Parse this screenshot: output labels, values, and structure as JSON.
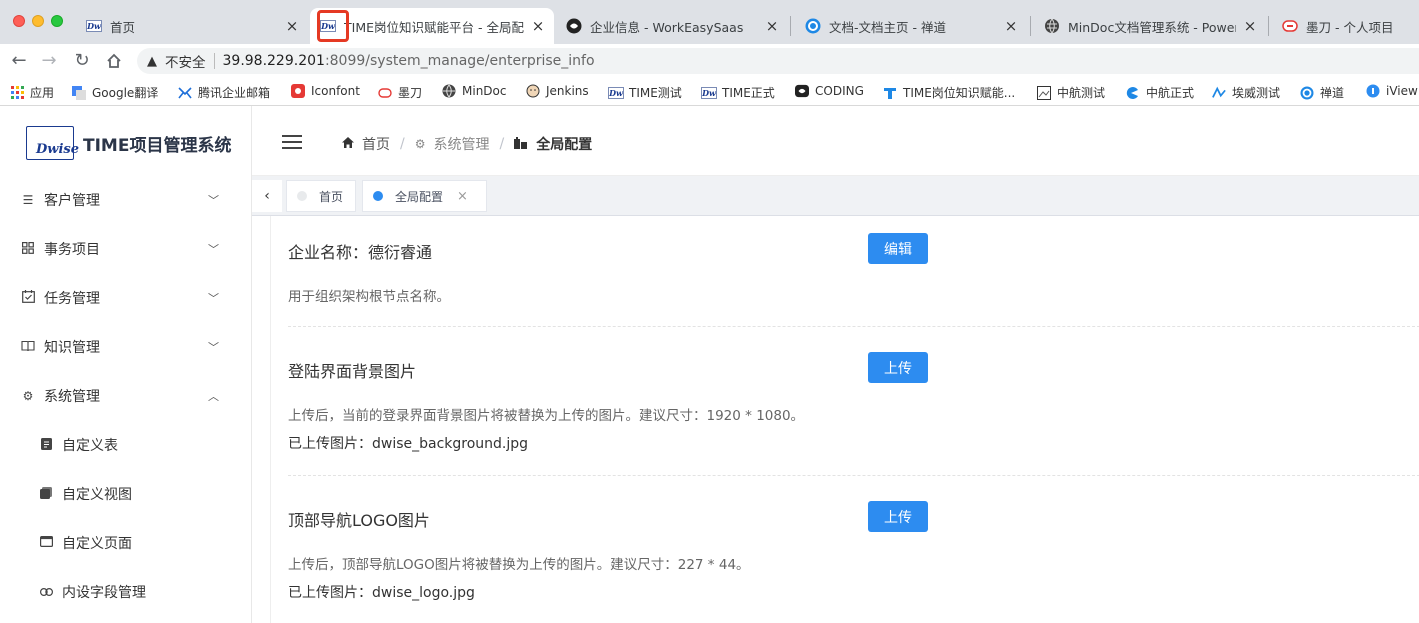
{
  "browser": {
    "tabs": [
      {
        "title": "首页",
        "favicon": "dwise-logo-icon",
        "active": false
      },
      {
        "title": "TIME岗位知识赋能平台 - 全局配",
        "favicon": "dwise-logo-icon",
        "active": true
      },
      {
        "title": "企业信息 - WorkEasySaas",
        "favicon": "workeasy-icon",
        "active": false
      },
      {
        "title": "文档-文档主页 - 禅道",
        "favicon": "zentao-icon",
        "active": false
      },
      {
        "title": "MinDoc文档管理系统 - Powered",
        "favicon": "globe-icon",
        "active": false
      },
      {
        "title": "墨刀 - 个人项目",
        "favicon": "modao-icon",
        "active": false
      }
    ],
    "address": {
      "security_label": "不安全",
      "host": "39.98.229.201",
      "path": ":8099/system_manage/enterprise_info"
    },
    "bookmarks": [
      {
        "label": "应用",
        "icon": "apps-grid-icon"
      },
      {
        "label": "Google翻译",
        "icon": "google-translate-icon"
      },
      {
        "label": "腾讯企业邮箱",
        "icon": "tencent-mail-icon"
      },
      {
        "label": "Iconfont",
        "icon": "iconfont-icon"
      },
      {
        "label": "墨刀",
        "icon": "modao-icon"
      },
      {
        "label": "MinDoc",
        "icon": "globe-icon"
      },
      {
        "label": "Jenkins",
        "icon": "jenkins-icon"
      },
      {
        "label": "TIME测试",
        "icon": "dwise-logo-icon"
      },
      {
        "label": "TIME正式",
        "icon": "dwise-logo-icon"
      },
      {
        "label": "CODING",
        "icon": "coding-icon"
      },
      {
        "label": "TIME岗位知识赋能...",
        "icon": "time-platform-icon"
      },
      {
        "label": "中航测试",
        "icon": "image-icon"
      },
      {
        "label": "中航正式",
        "icon": "edge-icon"
      },
      {
        "label": "埃威测试",
        "icon": "aiwei-icon"
      },
      {
        "label": "禅道",
        "icon": "zentao-icon"
      },
      {
        "label": "iView",
        "icon": "iview-icon"
      }
    ]
  },
  "app": {
    "logo_badge": "Dwise",
    "brand": "TIME项目管理系统",
    "menu": [
      {
        "label": "客户管理",
        "icon": "list-icon",
        "expanded": false
      },
      {
        "label": "事务项目",
        "icon": "grid-icon",
        "expanded": false
      },
      {
        "label": "任务管理",
        "icon": "calendar-check-icon",
        "expanded": false
      },
      {
        "label": "知识管理",
        "icon": "book-icon",
        "expanded": false
      },
      {
        "label": "系统管理",
        "icon": "gear-icon",
        "expanded": true
      }
    ],
    "submenu": [
      {
        "label": "自定义表",
        "icon": "doc-icon"
      },
      {
        "label": "自定义视图",
        "icon": "copy-icon"
      },
      {
        "label": "自定义页面",
        "icon": "window-icon"
      },
      {
        "label": "内设字段管理",
        "icon": "link-icon"
      }
    ],
    "breadcrumb": [
      {
        "label": "首页",
        "icon": "home-icon"
      },
      {
        "label": "系统管理",
        "icon": "gear-icon"
      },
      {
        "label": "全局配置",
        "icon": "building-icon"
      }
    ],
    "page_tabs": [
      {
        "label": "首页",
        "dot_color": "#e8eaec",
        "closable": false
      },
      {
        "label": "全局配置",
        "dot_color": "#2d8cf0",
        "closable": true
      }
    ],
    "sections": [
      {
        "title": "企业名称：德衍睿通",
        "button": "编辑",
        "description": "用于组织架构根节点名称。",
        "file": ""
      },
      {
        "title": "登陆界面背景图片",
        "button": "上传",
        "description": "上传后，当前的登录界面背景图片将被替换为上传的图片。建议尺寸：1920 * 1080。",
        "file": "已上传图片：dwise_background.jpg"
      },
      {
        "title": "顶部导航LOGO图片",
        "button": "上传",
        "description": "上传后，顶部导航LOGO图片将被替换为上传的图片。建议尺寸：227 * 44。",
        "file": "已上传图片：dwise_logo.jpg"
      }
    ],
    "colors": {
      "primary": "#2d8cf0",
      "annotation": "#e53923"
    }
  }
}
